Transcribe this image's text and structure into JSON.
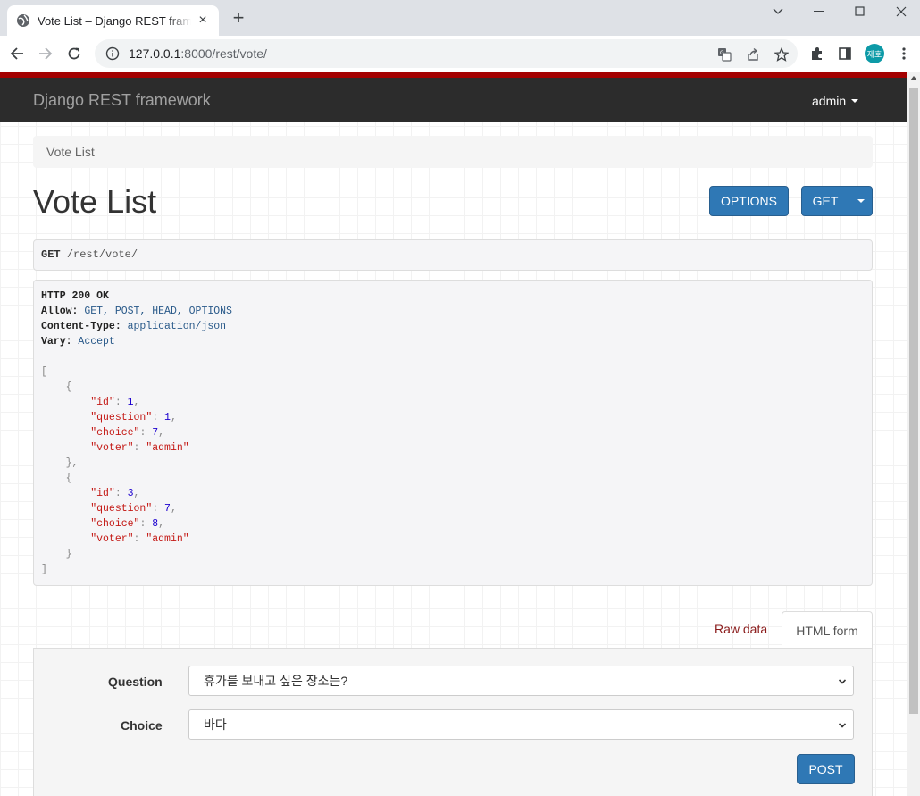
{
  "browser": {
    "tab_title": "Vote List – Django REST framework",
    "url_host": "127.0.0.1",
    "url_rest": ":8000/rest/vote/",
    "profile_initials": "재호"
  },
  "navbar": {
    "brand": "Django REST framework",
    "user": "admin"
  },
  "breadcrumb": "Vote List",
  "page_title": "Vote List",
  "buttons": {
    "options": "OPTIONS",
    "get": "GET",
    "post": "POST"
  },
  "request": {
    "method": "GET",
    "path": "/rest/vote/"
  },
  "response": {
    "status": "HTTP 200 OK",
    "headers": [
      {
        "key": "Allow:",
        "value": "GET, POST, HEAD, OPTIONS"
      },
      {
        "key": "Content-Type:",
        "value": "application/json"
      },
      {
        "key": "Vary:",
        "value": "Accept"
      }
    ],
    "votes": [
      {
        "id": 1,
        "question": 1,
        "choice": 7,
        "voter": "admin"
      },
      {
        "id": 3,
        "question": 7,
        "choice": 8,
        "voter": "admin"
      }
    ]
  },
  "tabs": {
    "raw": "Raw data",
    "html": "HTML form"
  },
  "form": {
    "question_label": "Question",
    "question_value": "휴가를 보내고 싶은 장소는?",
    "choice_label": "Choice",
    "choice_value": "바다"
  },
  "colors": {
    "accent": "#2f78b5",
    "navbar": "#2c2c2c",
    "topline": "#a30000"
  }
}
